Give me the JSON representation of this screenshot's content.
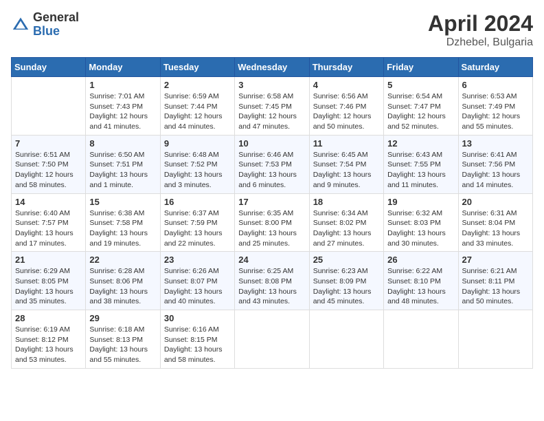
{
  "header": {
    "logo_general": "General",
    "logo_blue": "Blue",
    "month": "April 2024",
    "location": "Dzhebel, Bulgaria"
  },
  "days_of_week": [
    "Sunday",
    "Monday",
    "Tuesday",
    "Wednesday",
    "Thursday",
    "Friday",
    "Saturday"
  ],
  "weeks": [
    [
      {
        "day": "",
        "sunrise": "",
        "sunset": "",
        "daylight": ""
      },
      {
        "day": "1",
        "sunrise": "Sunrise: 7:01 AM",
        "sunset": "Sunset: 7:43 PM",
        "daylight": "Daylight: 12 hours and 41 minutes."
      },
      {
        "day": "2",
        "sunrise": "Sunrise: 6:59 AM",
        "sunset": "Sunset: 7:44 PM",
        "daylight": "Daylight: 12 hours and 44 minutes."
      },
      {
        "day": "3",
        "sunrise": "Sunrise: 6:58 AM",
        "sunset": "Sunset: 7:45 PM",
        "daylight": "Daylight: 12 hours and 47 minutes."
      },
      {
        "day": "4",
        "sunrise": "Sunrise: 6:56 AM",
        "sunset": "Sunset: 7:46 PM",
        "daylight": "Daylight: 12 hours and 50 minutes."
      },
      {
        "day": "5",
        "sunrise": "Sunrise: 6:54 AM",
        "sunset": "Sunset: 7:47 PM",
        "daylight": "Daylight: 12 hours and 52 minutes."
      },
      {
        "day": "6",
        "sunrise": "Sunrise: 6:53 AM",
        "sunset": "Sunset: 7:49 PM",
        "daylight": "Daylight: 12 hours and 55 minutes."
      }
    ],
    [
      {
        "day": "7",
        "sunrise": "Sunrise: 6:51 AM",
        "sunset": "Sunset: 7:50 PM",
        "daylight": "Daylight: 12 hours and 58 minutes."
      },
      {
        "day": "8",
        "sunrise": "Sunrise: 6:50 AM",
        "sunset": "Sunset: 7:51 PM",
        "daylight": "Daylight: 13 hours and 1 minute."
      },
      {
        "day": "9",
        "sunrise": "Sunrise: 6:48 AM",
        "sunset": "Sunset: 7:52 PM",
        "daylight": "Daylight: 13 hours and 3 minutes."
      },
      {
        "day": "10",
        "sunrise": "Sunrise: 6:46 AM",
        "sunset": "Sunset: 7:53 PM",
        "daylight": "Daylight: 13 hours and 6 minutes."
      },
      {
        "day": "11",
        "sunrise": "Sunrise: 6:45 AM",
        "sunset": "Sunset: 7:54 PM",
        "daylight": "Daylight: 13 hours and 9 minutes."
      },
      {
        "day": "12",
        "sunrise": "Sunrise: 6:43 AM",
        "sunset": "Sunset: 7:55 PM",
        "daylight": "Daylight: 13 hours and 11 minutes."
      },
      {
        "day": "13",
        "sunrise": "Sunrise: 6:41 AM",
        "sunset": "Sunset: 7:56 PM",
        "daylight": "Daylight: 13 hours and 14 minutes."
      }
    ],
    [
      {
        "day": "14",
        "sunrise": "Sunrise: 6:40 AM",
        "sunset": "Sunset: 7:57 PM",
        "daylight": "Daylight: 13 hours and 17 minutes."
      },
      {
        "day": "15",
        "sunrise": "Sunrise: 6:38 AM",
        "sunset": "Sunset: 7:58 PM",
        "daylight": "Daylight: 13 hours and 19 minutes."
      },
      {
        "day": "16",
        "sunrise": "Sunrise: 6:37 AM",
        "sunset": "Sunset: 7:59 PM",
        "daylight": "Daylight: 13 hours and 22 minutes."
      },
      {
        "day": "17",
        "sunrise": "Sunrise: 6:35 AM",
        "sunset": "Sunset: 8:00 PM",
        "daylight": "Daylight: 13 hours and 25 minutes."
      },
      {
        "day": "18",
        "sunrise": "Sunrise: 6:34 AM",
        "sunset": "Sunset: 8:02 PM",
        "daylight": "Daylight: 13 hours and 27 minutes."
      },
      {
        "day": "19",
        "sunrise": "Sunrise: 6:32 AM",
        "sunset": "Sunset: 8:03 PM",
        "daylight": "Daylight: 13 hours and 30 minutes."
      },
      {
        "day": "20",
        "sunrise": "Sunrise: 6:31 AM",
        "sunset": "Sunset: 8:04 PM",
        "daylight": "Daylight: 13 hours and 33 minutes."
      }
    ],
    [
      {
        "day": "21",
        "sunrise": "Sunrise: 6:29 AM",
        "sunset": "Sunset: 8:05 PM",
        "daylight": "Daylight: 13 hours and 35 minutes."
      },
      {
        "day": "22",
        "sunrise": "Sunrise: 6:28 AM",
        "sunset": "Sunset: 8:06 PM",
        "daylight": "Daylight: 13 hours and 38 minutes."
      },
      {
        "day": "23",
        "sunrise": "Sunrise: 6:26 AM",
        "sunset": "Sunset: 8:07 PM",
        "daylight": "Daylight: 13 hours and 40 minutes."
      },
      {
        "day": "24",
        "sunrise": "Sunrise: 6:25 AM",
        "sunset": "Sunset: 8:08 PM",
        "daylight": "Daylight: 13 hours and 43 minutes."
      },
      {
        "day": "25",
        "sunrise": "Sunrise: 6:23 AM",
        "sunset": "Sunset: 8:09 PM",
        "daylight": "Daylight: 13 hours and 45 minutes."
      },
      {
        "day": "26",
        "sunrise": "Sunrise: 6:22 AM",
        "sunset": "Sunset: 8:10 PM",
        "daylight": "Daylight: 13 hours and 48 minutes."
      },
      {
        "day": "27",
        "sunrise": "Sunrise: 6:21 AM",
        "sunset": "Sunset: 8:11 PM",
        "daylight": "Daylight: 13 hours and 50 minutes."
      }
    ],
    [
      {
        "day": "28",
        "sunrise": "Sunrise: 6:19 AM",
        "sunset": "Sunset: 8:12 PM",
        "daylight": "Daylight: 13 hours and 53 minutes."
      },
      {
        "day": "29",
        "sunrise": "Sunrise: 6:18 AM",
        "sunset": "Sunset: 8:13 PM",
        "daylight": "Daylight: 13 hours and 55 minutes."
      },
      {
        "day": "30",
        "sunrise": "Sunrise: 6:16 AM",
        "sunset": "Sunset: 8:15 PM",
        "daylight": "Daylight: 13 hours and 58 minutes."
      },
      {
        "day": "",
        "sunrise": "",
        "sunset": "",
        "daylight": ""
      },
      {
        "day": "",
        "sunrise": "",
        "sunset": "",
        "daylight": ""
      },
      {
        "day": "",
        "sunrise": "",
        "sunset": "",
        "daylight": ""
      },
      {
        "day": "",
        "sunrise": "",
        "sunset": "",
        "daylight": ""
      }
    ]
  ]
}
